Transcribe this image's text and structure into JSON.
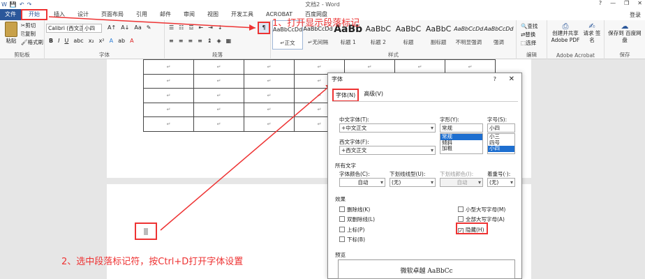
{
  "titlebar": {
    "title": "文档2 - Word",
    "help": "?",
    "minimize": "—",
    "restore": "❐",
    "close": "✕"
  },
  "tabs": [
    "文件",
    "开始",
    "插入",
    "设计",
    "页面布局",
    "引用",
    "邮件",
    "审阅",
    "视图",
    "开发工具",
    "ACROBAT",
    "百度网盘"
  ],
  "login": "登录",
  "clipboard": {
    "paste": "粘贴",
    "cut": "剪切",
    "copy": "复制",
    "painter": "格式刷",
    "group": "剪贴板"
  },
  "font": {
    "name": "Calibri (西文正文",
    "size": "小四",
    "group": "字体"
  },
  "paragraph": {
    "group": "段落"
  },
  "styles": {
    "group": "样式",
    "items": [
      {
        "preview": "AaBbCcDd",
        "name": "↵正文"
      },
      {
        "preview": "AaBbCcDd",
        "name": "↵无间隔"
      },
      {
        "preview": "AaBb",
        "name": "标题 1"
      },
      {
        "preview": "AaBbC",
        "name": "标题 2"
      },
      {
        "preview": "AaBbC",
        "name": "标题"
      },
      {
        "preview": "AaBbC",
        "name": "副标题"
      },
      {
        "preview": "AaBbCcDd",
        "name": "不明显强调"
      },
      {
        "preview": "AaBbCcDd",
        "name": "强调"
      }
    ]
  },
  "editing": {
    "find": "查找",
    "replace": "替换",
    "select": "选择",
    "group": "编辑"
  },
  "acrobat": {
    "create": "创建并共享 Adobe PDF",
    "sign": "请求 签名",
    "group": "Adobe Acrobat"
  },
  "save": {
    "label": "保存到 百度网盘",
    "group": "保存"
  },
  "table_cells": [
    "↵"
  ],
  "annotations": {
    "step1": "1、打开显示段落标记",
    "step2": "2、选中段落标记符，按Ctrl+D打开字体设置"
  },
  "dialog": {
    "title": "字体",
    "help": "?",
    "close": "✕",
    "tab_font": "字体(N)",
    "tab_advanced": "高级(V)",
    "cn_font_label": "中文字体(T):",
    "cn_font_value": "+中文正文",
    "style_label": "字形(Y):",
    "style_value": "常规",
    "style_options": [
      "常规",
      "倾斜",
      "加粗"
    ],
    "size_label": "字号(S):",
    "size_value": "小四",
    "size_options": [
      "小三",
      "四号",
      "小四"
    ],
    "west_font_label": "西文字体(F):",
    "west_font_value": "+西文正文",
    "all_text": "所有文字",
    "color_label": "字体颜色(C):",
    "color_value": "自动",
    "underline_label": "下划线线型(U):",
    "underline_value": "(无)",
    "underline_color_label": "下划线颜色(I):",
    "underline_color_value": "自动",
    "emphasis_label": "着重号(·):",
    "emphasis_value": "(无)",
    "effects": "效果",
    "strike": "删除线(K)",
    "dstrike": "双删除线(L)",
    "sup": "上标(P)",
    "sub": "下标(B)",
    "smallcaps": "小型大写字母(M)",
    "allcaps": "全部大写字母(A)",
    "hidden": "隐藏(H)",
    "preview_label": "预览",
    "preview_text": "微软卓越 AaBbCc"
  }
}
